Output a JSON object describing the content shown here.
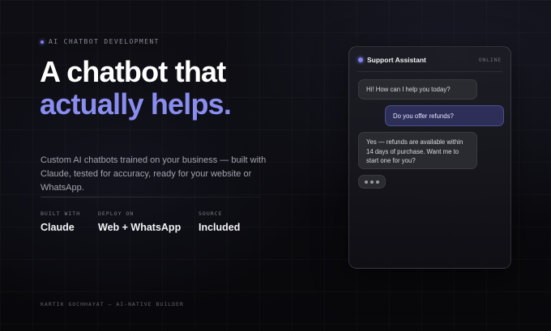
{
  "eyebrow": {
    "text": "AI CHATBOT DEVELOPMENT"
  },
  "headline": {
    "line1": "A chatbot that",
    "line2": "actually helps."
  },
  "description": "Custom AI chatbots trained on your business — built with Claude, tested for accuracy, ready for your website or WhatsApp.",
  "stats": [
    {
      "label": "BUILT WITH",
      "value": "Claude"
    },
    {
      "label": "DEPLOY ON",
      "value": "Web + WhatsApp"
    },
    {
      "label": "SOURCE",
      "value": "Included"
    }
  ],
  "footer": {
    "text": "KARTIK GOCHHAYAT — AI-NATIVE BUILDER"
  },
  "chat": {
    "title": "Support Assistant",
    "status": "ONLINE",
    "messages": [
      {
        "role": "bot",
        "text": "Hi! How can I help you today?"
      },
      {
        "role": "user",
        "text": "Do you offer refunds?"
      },
      {
        "role": "bot",
        "text": "Yes — refunds are available within 14 days of purchase. Want me to start one for you?"
      }
    ],
    "typing_indicator": "typing-dots-icon"
  },
  "colors": {
    "accent": "#8a8df0",
    "background": "#0a0a0e",
    "user_bubble": "#2d2f58",
    "bot_bubble": "#2a2a31"
  }
}
